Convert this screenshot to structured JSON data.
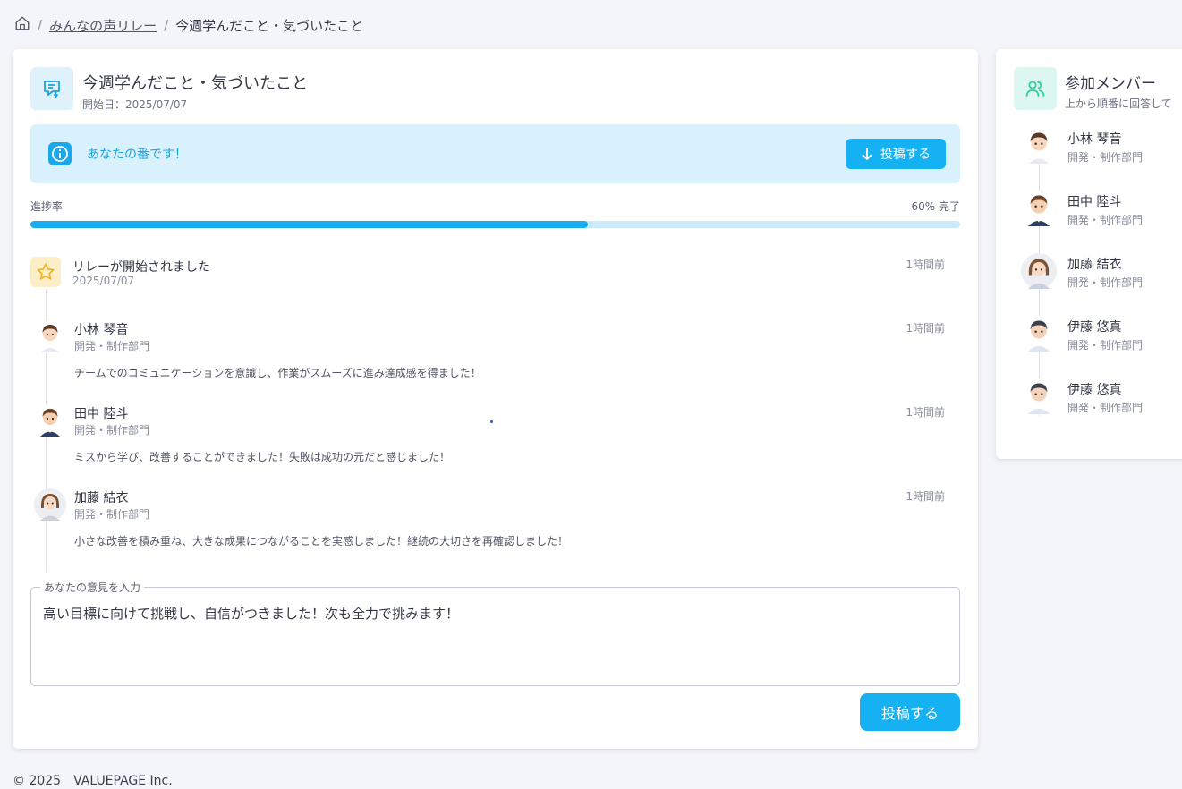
{
  "breadcrumb": {
    "home_icon": "home-icon",
    "separator": "/",
    "parent": "みんなの声リレー",
    "current": "今週学んだこと・気づいたこと"
  },
  "relay": {
    "title": "今週学んだこと・気づいたこと",
    "start_date": "開始日：2025/07/07",
    "icon": "message-edit-icon"
  },
  "turn_alert": {
    "text": "あなたの番です！",
    "button_label": "投稿する",
    "icon": "info-icon"
  },
  "progress": {
    "label": "進捗率",
    "percent": 60,
    "value_text": "60% 完了"
  },
  "timeline": {
    "start": {
      "text": "リレーが開始されました",
      "date": "2025/07/07",
      "time": "1時間前",
      "icon": "star-icon"
    },
    "posts": [
      {
        "name": "小林 琴音",
        "dept": "開発・制作部門",
        "time": "1時間前",
        "message": "チームでのコミュニケーションを意識し、作業がスムーズに進み達成感を得ました！"
      },
      {
        "name": "田中 陸斗",
        "dept": "開発・制作部門",
        "time": "1時間前",
        "message": "ミスから学び、改善することができました！失敗は成功の元だと感じました！"
      },
      {
        "name": "加藤 結衣",
        "dept": "開発・制作部門",
        "time": "1時間前",
        "message": "小さな改善を積み重ね、大きな成果につながることを実感しました！継続の大切さを再確認しました！"
      }
    ]
  },
  "opinion": {
    "label": "あなたの意見を入力",
    "value": "高い目標に向けて挑戦し、自信がつきました！次も全力で挑みます！",
    "submit_label": "投稿する"
  },
  "members": {
    "title": "参加メンバー",
    "subtitle": "上から順番に回答して",
    "icon": "users-icon",
    "items": [
      {
        "name": "小林 琴音",
        "dept": "開発・制作部門"
      },
      {
        "name": "田中 陸斗",
        "dept": "開発・制作部門"
      },
      {
        "name": "加藤 結衣",
        "dept": "開発・制作部門"
      },
      {
        "name": "伊藤 悠真",
        "dept": "開発・制作部門"
      },
      {
        "name": "伊藤 悠真",
        "dept": "開発・制作部門"
      }
    ]
  },
  "footer": {
    "copyright": "© 2025　VALUEPAGE Inc."
  },
  "colors": {
    "accent": "#16b1f2",
    "alert_bg": "#d9f1fc",
    "star_bg": "#fcefc8",
    "members_icon_bg": "#dcf7ef"
  }
}
